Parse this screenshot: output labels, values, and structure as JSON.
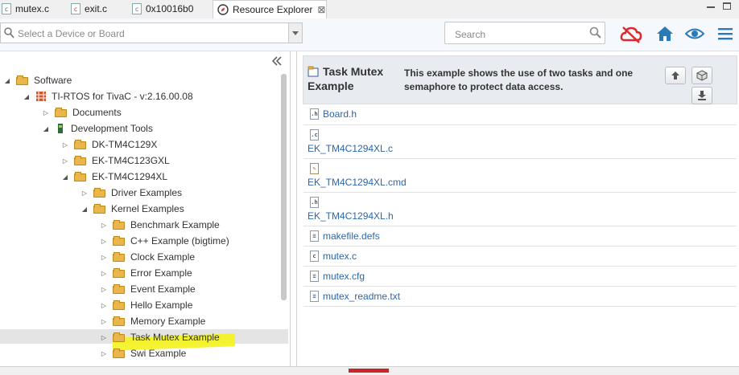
{
  "tabs": [
    {
      "label": "mutex.c",
      "icon": "c-file-icon"
    },
    {
      "label": "exit.c",
      "icon": "c-file-error-icon"
    },
    {
      "label": "0x10016b0",
      "icon": "disassembly-icon"
    },
    {
      "label": "Resource Explorer",
      "icon": "compass-icon",
      "close": "⊠"
    }
  ],
  "toolbar": {
    "device_placeholder": "Select a Device or Board",
    "search_placeholder": "Search"
  },
  "tree": [
    {
      "label": "Software",
      "expanded": true
    },
    {
      "label": "TI-RTOS for TivaC - v:2.16.00.08",
      "expanded": true
    },
    {
      "label": "Documents",
      "expanded": false
    },
    {
      "label": "Development Tools",
      "expanded": true
    },
    {
      "label": "DK-TM4C129X",
      "expanded": false
    },
    {
      "label": "EK-TM4C123GXL",
      "expanded": false
    },
    {
      "label": "EK-TM4C1294XL",
      "expanded": true
    },
    {
      "label": "Driver Examples",
      "expanded": false
    },
    {
      "label": "Kernel Examples",
      "expanded": true
    },
    {
      "label": "Benchmark Example"
    },
    {
      "label": "C++ Example (bigtime)"
    },
    {
      "label": "Clock Example"
    },
    {
      "label": "Error Example"
    },
    {
      "label": "Event Example"
    },
    {
      "label": "Hello Example"
    },
    {
      "label": "Memory Example"
    },
    {
      "label": "Task Mutex Example",
      "selected": true
    },
    {
      "label": "Swi Example"
    }
  ],
  "detail": {
    "title_line1": "Task Mutex",
    "title_line2": "Example",
    "desc_line1": "This example shows the use of two tasks and one",
    "desc_line2": "semaphore to protect data access."
  },
  "files": [
    {
      "name": "Board.h",
      "icon": "header-file-icon",
      "glyph": ".h"
    },
    {
      "name": "EK_TM4C1294XL.c",
      "icon": "c-file-icon",
      "glyph": ".c"
    },
    {
      "name": "EK_TM4C1294XL.cmd",
      "icon": "cmd-file-icon",
      "glyph": "✎"
    },
    {
      "name": "EK_TM4C1294XL.h",
      "icon": "header-file-icon",
      "glyph": ".h"
    },
    {
      "name": "makefile.defs",
      "icon": "text-file-icon",
      "glyph": "≡"
    },
    {
      "name": "mutex.c",
      "icon": "c-file-icon",
      "glyph": "c"
    },
    {
      "name": "mutex.cfg",
      "icon": "text-file-icon",
      "glyph": "≡"
    },
    {
      "name": "mutex_readme.txt",
      "icon": "text-file-icon",
      "glyph": "≡"
    }
  ],
  "colors": {
    "accent_red": "#e0262b",
    "accent_blue": "#2a7ab8",
    "link": "#2e66a8",
    "highlight": "#f3f31c"
  }
}
